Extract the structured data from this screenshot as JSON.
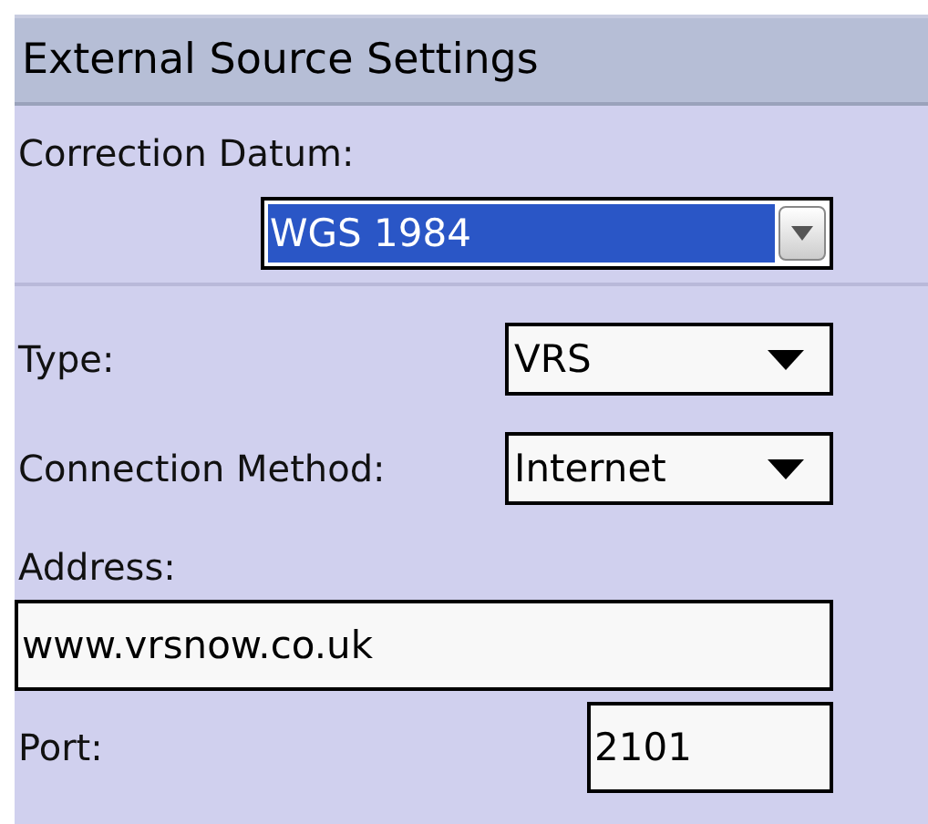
{
  "header": {
    "title": "External Source Settings"
  },
  "fields": [
    {
      "kind": "dropdown-below",
      "label": "Correction Datum:",
      "value": "WGS 1984",
      "focused": true
    },
    {
      "kind": "divider"
    },
    {
      "kind": "dropdown",
      "label": "Type:",
      "value": "VRS",
      "focused": false
    },
    {
      "kind": "dropdown",
      "label": "Connection Method:",
      "value": "Internet",
      "focused": false
    },
    {
      "kind": "text-below",
      "label": "Address:",
      "value": "www.vrsnow.co.uk"
    },
    {
      "kind": "text",
      "label": "Port:",
      "value": "2101"
    }
  ]
}
